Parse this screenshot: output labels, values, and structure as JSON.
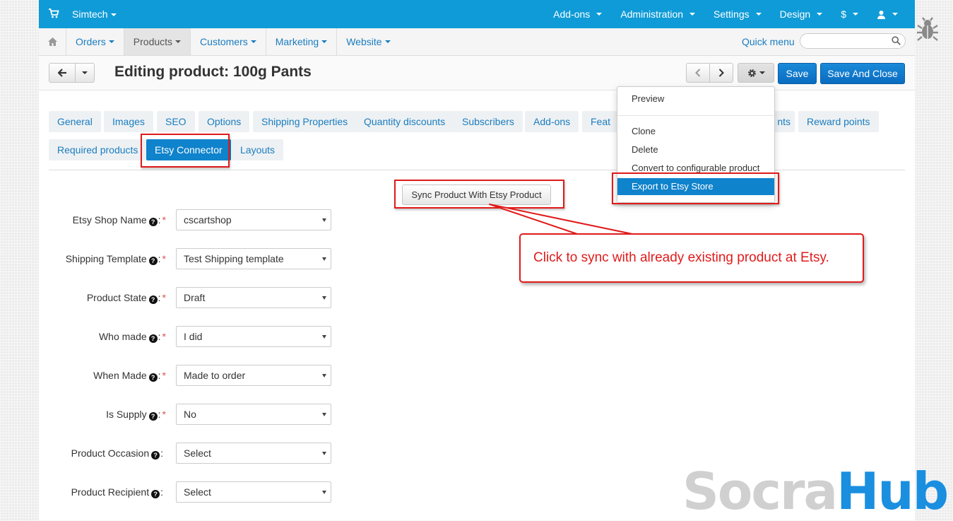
{
  "topbar": {
    "brand": "Simtech",
    "menus": [
      "Add-ons",
      "Administration",
      "Settings",
      "Design",
      "$",
      ""
    ]
  },
  "subnav": {
    "items": [
      "Orders",
      "Products",
      "Customers",
      "Marketing",
      "Website"
    ],
    "active": "Products",
    "quick_menu": "Quick menu",
    "search_placeholder": ""
  },
  "header": {
    "title": "Editing product: 100g Pants",
    "save": "Save",
    "save_close": "Save And Close"
  },
  "tabs_row1": [
    "General",
    "Images",
    "SEO",
    "Options",
    "Shipping Properties",
    "Quantity discounts",
    "Subscribers",
    "Add-ons",
    "Feat",
    "nts",
    "Reward points"
  ],
  "tabs_row2": [
    "Required products",
    "Etsy Connector",
    "Layouts"
  ],
  "active_tab": "Etsy Connector",
  "sync_button": "Sync Product With Etsy Product",
  "form": [
    {
      "label": "Etsy Shop Name",
      "required": true,
      "value": "cscartshop"
    },
    {
      "label": "Shipping Template",
      "required": true,
      "value": "Test Shipping template"
    },
    {
      "label": "Product State",
      "required": true,
      "value": "Draft"
    },
    {
      "label": "Who made",
      "required": true,
      "value": "I did"
    },
    {
      "label": "When Made",
      "required": true,
      "value": "Made to order"
    },
    {
      "label": "Is Supply",
      "required": true,
      "value": "No"
    },
    {
      "label": "Product Occasion",
      "required": false,
      "value": "Select"
    },
    {
      "label": "Product Recipient",
      "required": false,
      "value": "Select"
    }
  ],
  "dropdown": {
    "items": [
      "Preview",
      "Clone",
      "Delete",
      "Convert to configurable product",
      "Export to Etsy Store"
    ],
    "highlighted": "Export to Etsy Store"
  },
  "callout": "Click to sync with already existing product at Etsy.",
  "watermark": {
    "part1": "Socra",
    "part2": "Hub",
    "color1": "#d0d0d0",
    "color2": "#1a8fe0"
  },
  "colors": {
    "topbar": "#0f9bd7",
    "link": "#1a7dc0",
    "primary": "#0f83cc",
    "annotation": "#e01b1b"
  }
}
